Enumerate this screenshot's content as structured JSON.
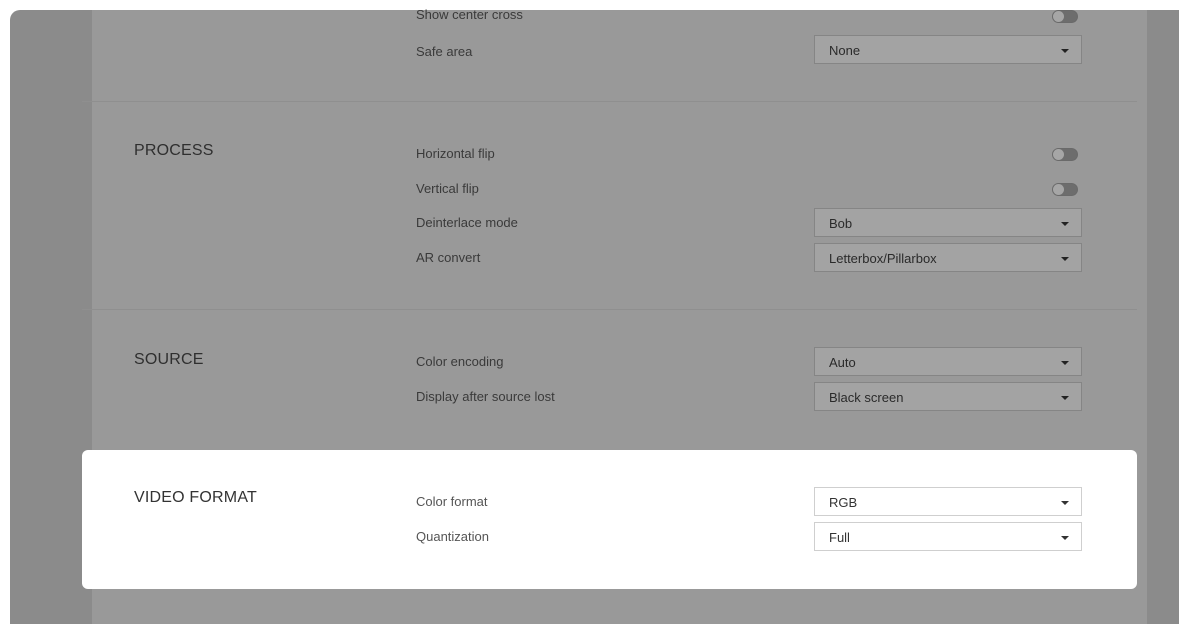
{
  "display": {
    "rows": [
      {
        "label": "Show center cross",
        "type": "toggle"
      },
      {
        "label": "Safe area",
        "type": "select",
        "value": "None"
      }
    ]
  },
  "process": {
    "title": "PROCESS",
    "rows": [
      {
        "label": "Horizontal flip",
        "type": "toggle"
      },
      {
        "label": "Vertical flip",
        "type": "toggle"
      },
      {
        "label": "Deinterlace mode",
        "type": "select",
        "value": "Bob"
      },
      {
        "label": "AR convert",
        "type": "select",
        "value": "Letterbox/Pillarbox"
      }
    ]
  },
  "source": {
    "title": "SOURCE",
    "rows": [
      {
        "label": "Color encoding",
        "type": "select",
        "value": "Auto"
      },
      {
        "label": "Display after source lost",
        "type": "select",
        "value": "Black screen"
      }
    ]
  },
  "video_format": {
    "title": "VIDEO FORMAT",
    "rows": [
      {
        "label": "Color format",
        "type": "select",
        "value": "RGB"
      },
      {
        "label": "Quantization",
        "type": "select",
        "value": "Full"
      }
    ]
  }
}
